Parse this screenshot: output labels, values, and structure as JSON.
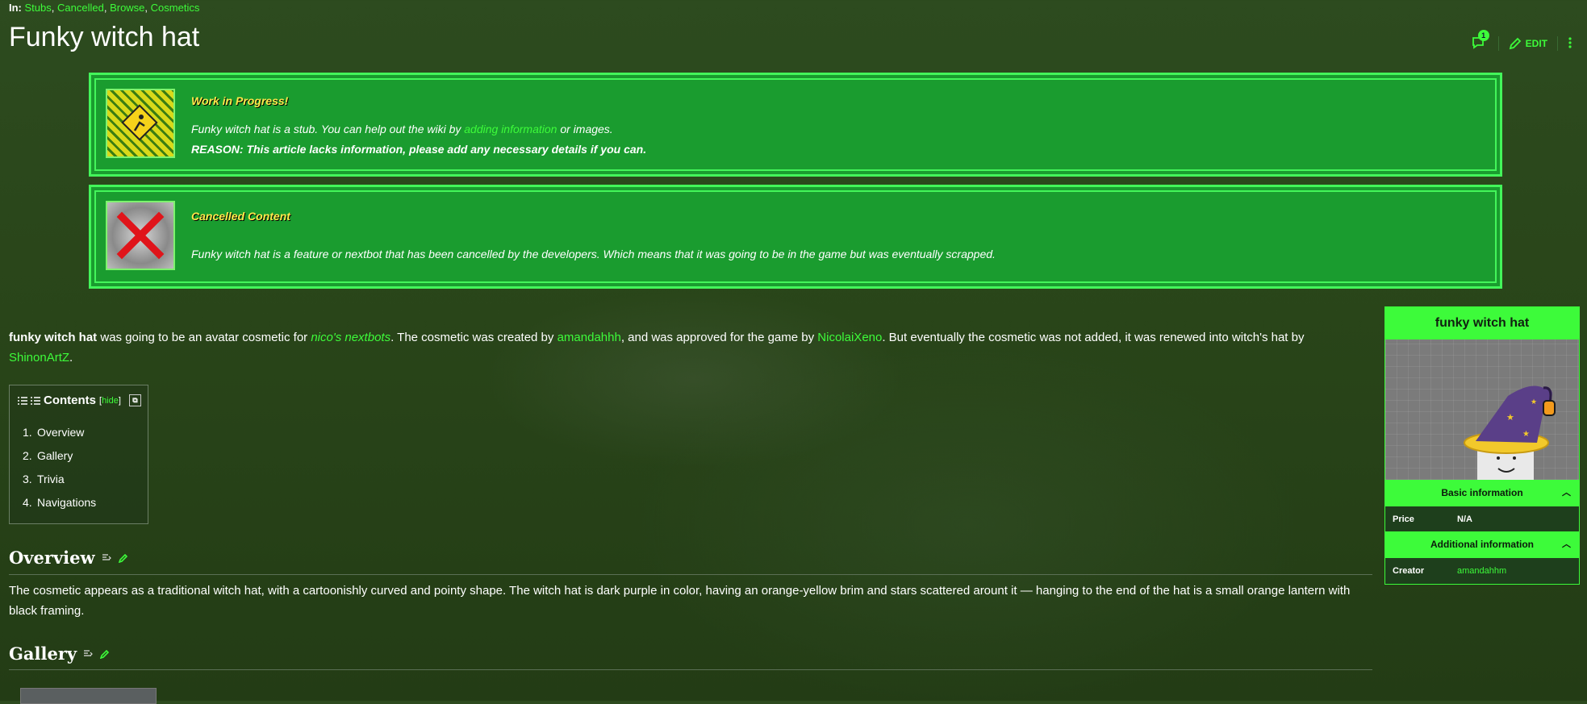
{
  "categories": {
    "prefix": "In:",
    "items": [
      "Stubs",
      "Cancelled",
      "Browse",
      "Cosmetics"
    ]
  },
  "page": {
    "title": "Funky witch hat"
  },
  "toolbar": {
    "comment_count": "1",
    "edit_label": "EDIT"
  },
  "notices": [
    {
      "title": "Work in Progress!",
      "text_before": "Funky witch hat is a stub. You can help out the wiki by ",
      "link": "adding information",
      "text_after": " or images.",
      "reason": "REASON: This article lacks information, please add any necessary details if you can."
    },
    {
      "title": "Cancelled Content",
      "text": "Funky witch hat is a feature or nextbot that has been cancelled by the developers. Which means that it was going to be in the game but was eventually scrapped."
    }
  ],
  "intro": {
    "subject": "funky witch hat",
    "t1": " was going to be an avatar cosmetic for ",
    "game_link": "nico's nextbots",
    "t2": ". The cosmetic was created by ",
    "creator_link": "amandahhh",
    "t3": ", and was approved for the game by ",
    "approver_link": "NicolaiXeno",
    "t4": ". But eventually the cosmetic was not added, it was renewed into witch's hat by ",
    "renewer_link": "ShinonArtZ",
    "t5": "."
  },
  "toc": {
    "title": "Contents",
    "hide_label": "hide",
    "items": [
      {
        "num": "1.",
        "label": "Overview"
      },
      {
        "num": "2.",
        "label": "Gallery"
      },
      {
        "num": "3.",
        "label": "Trivia"
      },
      {
        "num": "4.",
        "label": "Navigations"
      }
    ]
  },
  "sections": {
    "overview": {
      "heading": "Overview",
      "text": "The cosmetic appears as a traditional witch hat, with a cartoonishly curved and pointy shape. The witch hat is dark purple in color, having an orange-yellow brim and stars scattered arount it — hanging to the end of the hat is a small orange lantern with black framing."
    },
    "gallery": {
      "heading": "Gallery"
    }
  },
  "infobox": {
    "title": "funky witch hat",
    "basic_header": "Basic information",
    "price_label": "Price",
    "price_value": "N/A",
    "additional_header": "Additional information",
    "creator_label": "Creator",
    "creator_value": "amandahhm"
  },
  "colors": {
    "accent": "#3dfb3a",
    "notice_bg": "#1a9c2f",
    "notice_title": "#ffe94a"
  }
}
